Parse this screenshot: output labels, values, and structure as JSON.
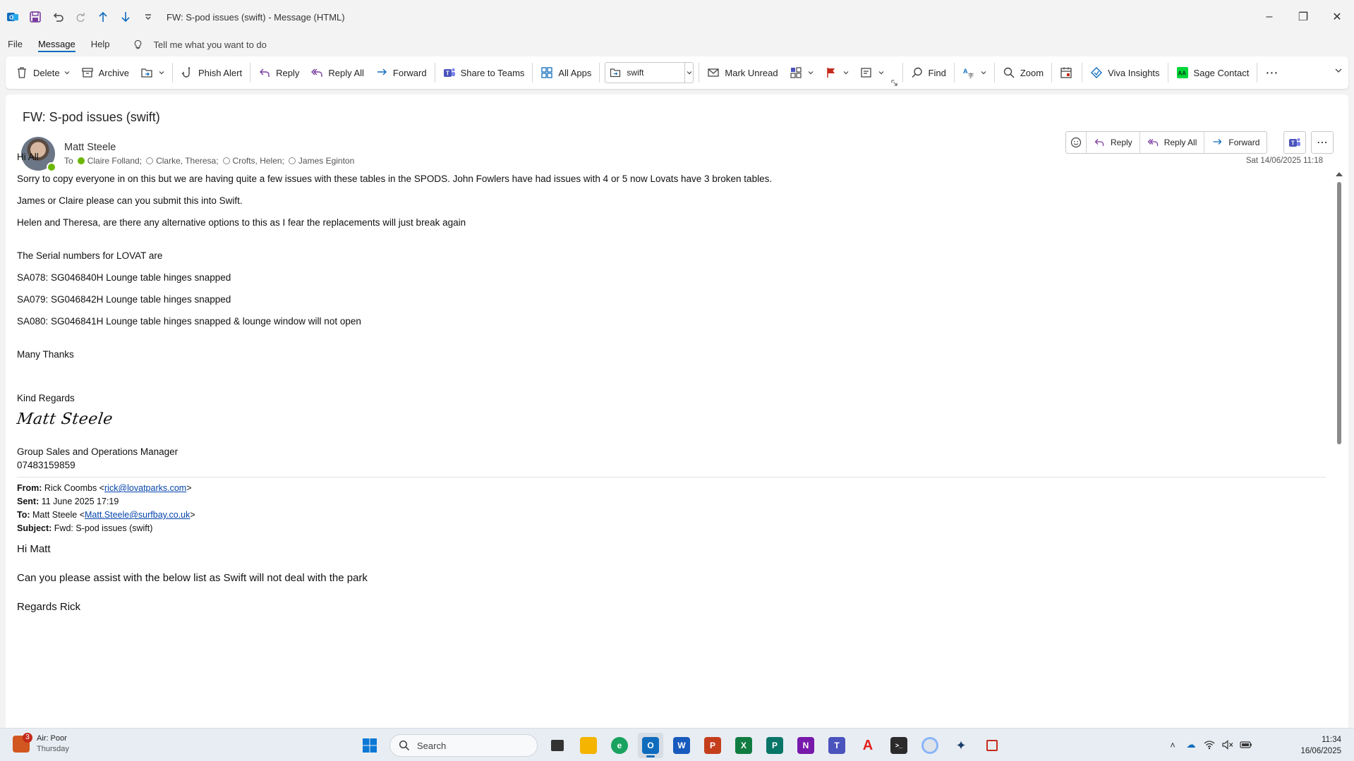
{
  "window": {
    "title": "FW: S-pod issues (swift)  -  Message (HTML)"
  },
  "menu": {
    "tabs": [
      "File",
      "Message",
      "Help"
    ],
    "active_tab": "Message",
    "tell_me": "Tell me what you want to do"
  },
  "ribbon": {
    "delete": "Delete",
    "archive": "Archive",
    "phish_alert": "Phish Alert",
    "reply": "Reply",
    "reply_all": "Reply All",
    "forward": "Forward",
    "share_to_teams": "Share to Teams",
    "all_apps": "All Apps",
    "quick_step": "swift",
    "mark_unread": "Mark Unread",
    "find": "Find",
    "zoom": "Zoom",
    "viva_insights": "Viva Insights",
    "sage_contact": "Sage Contact"
  },
  "message": {
    "subject": "FW: S-pod issues (swift)",
    "sender": "Matt Steele",
    "to_label": "To",
    "recipients": [
      "Claire Folland;",
      "Clarke, Theresa;",
      "Crofts, Helen;",
      "James Eginton"
    ],
    "date": "Sat 14/06/2025 11:18",
    "actions": {
      "reply": "Reply",
      "reply_all": "Reply All",
      "forward": "Forward"
    },
    "body": {
      "greeting": "Hi All",
      "p1": "Sorry to copy everyone in on this but we are having quite a few issues with these tables in the SPODS. John Fowlers have had issues with 4 or 5 now Lovats have 3 broken tables.",
      "p2": "James or Claire please can you submit this into Swift.",
      "p3": "Helen and Theresa, are there any alternative options to this as I fear the replacements will just break again",
      "p4": "The Serial numbers for LOVAT are",
      "serials": [
        "SA078: SG046840H Lounge table hinges snapped",
        "SA079: SG046842H Lounge table hinges snapped",
        "SA080: SG046841H Lounge table hinges snapped & lounge window will not open"
      ],
      "thanks": "Many Thanks",
      "regards": "Kind Regards",
      "signature": "Matt Steele",
      "job_title": "Group Sales and Operations Manager",
      "phone": "07483159859"
    },
    "forwarded": {
      "from_label": "From:",
      "from_name": "Rick Coombs <",
      "from_email": "rick@lovatparks.com",
      "sent_label": "Sent:",
      "sent": "11 June 2025 17:19",
      "to_label": "To:",
      "to_name": "Matt Steele <",
      "to_email": "Matt.Steele@surfbay.co.uk",
      "subject_label": "Subject:",
      "subject": "Fwd: S-pod issues (swift)",
      "greeting": "Hi Matt",
      "p1": "Can you please assist with the below list as Swift will not deal with the park",
      "signoff": "Regards Rick"
    }
  },
  "taskbar": {
    "weather_title": "Air: Poor",
    "weather_sub": "Thursday",
    "weather_badge": "3",
    "search_placeholder": "Search",
    "time": "11:34",
    "date": "16/06/2025"
  },
  "colors": {
    "accent": "#0f6cbd",
    "presence_available": "#6bb700",
    "link": "#0645ad"
  }
}
